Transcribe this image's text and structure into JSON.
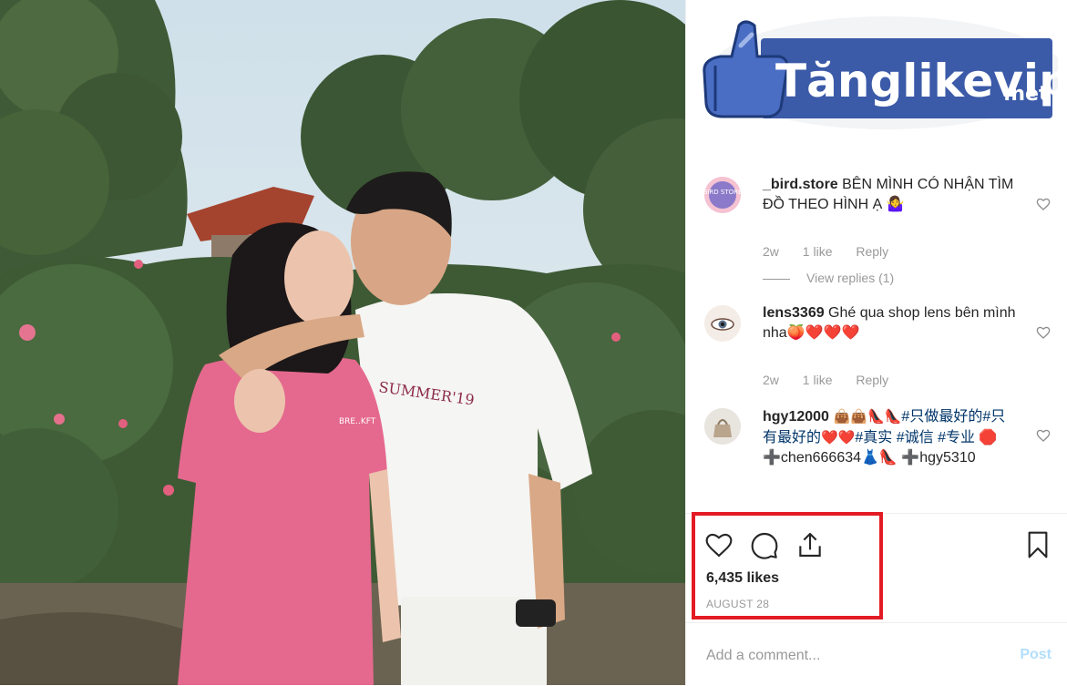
{
  "logo": {
    "text_main": "Tănglikevip",
    "text_suffix": ".net"
  },
  "comments": [
    {
      "user": "_bird.store",
      "text": " BÊN MÌNH CÓ NHẬN TÌM ĐỒ THEO HÌNH Ạ 🤷‍♀️",
      "avatar_text": "BIRD STORE",
      "time": "2w",
      "likes": "1 like",
      "reply": "Reply",
      "view_replies": "View replies (1)"
    },
    {
      "user": "lens3369",
      "text": " Ghé qua shop lens bên mình nha🍑❤️❤️❤️",
      "time": "2w",
      "likes": "1 like",
      "reply": "Reply"
    },
    {
      "user": "hgy12000",
      "text_plain": " 👜👜👠👠",
      "tags": "#只做最好的#只有最好的",
      "text_mid": "❤️❤️",
      "tags2": "#真实 #诚信 #专业",
      "text_end": " 🛑➕chen666634👗👠 ➕hgy5310"
    }
  ],
  "actions": {
    "likes": "6,435 likes",
    "date": "AUGUST 28"
  },
  "add_comment": {
    "placeholder": "Add a comment...",
    "post": "Post"
  },
  "colors": {
    "highlight": "#e21b24",
    "link": "#003569",
    "muted": "#999999",
    "post_disabled": "#b2dffc",
    "logo_blue": "#3b5aa8"
  }
}
